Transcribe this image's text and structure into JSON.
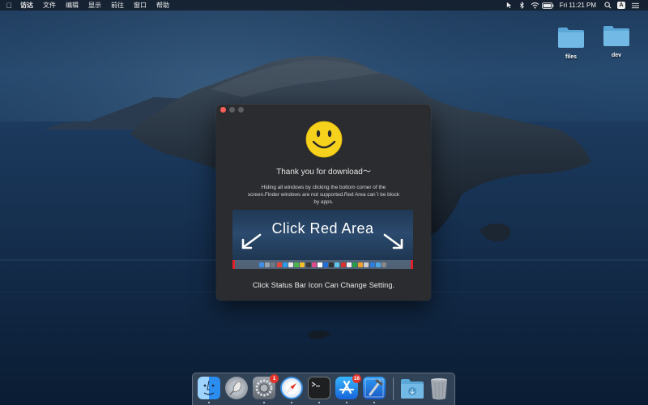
{
  "menubar": {
    "app_name": "访达",
    "items": [
      "文件",
      "编辑",
      "显示",
      "前往",
      "窗口",
      "帮助"
    ],
    "clock": "Fri 11:21 PM",
    "input_method": "A",
    "status_icons": [
      "cursor-icon",
      "bluetooth-icon",
      "wifi-icon",
      "battery-icon",
      "search-icon",
      "input-method-icon",
      "list-icon"
    ]
  },
  "desktop": {
    "folders": [
      {
        "label": "files",
        "icon": "folder-icon"
      },
      {
        "label": "dev",
        "icon": "folder-icon"
      }
    ]
  },
  "window": {
    "icon": "smiley-icon",
    "thanks": "Thank you for download～",
    "description_line1": "Hiding all windows by clicking the bottom corner of the",
    "description_line2": "screen.Finder windows are not supported.Red Area can`t be block",
    "description_line3": "by apps.",
    "demo_title": "Click  Red  Area",
    "status_tip": "Click Status Bar Icon Can Change Setting.",
    "accent_red": "#e0202a"
  },
  "dock": {
    "apps": [
      {
        "name": "Finder",
        "icon": "finder-icon",
        "running": true
      },
      {
        "name": "Launchpad",
        "icon": "launchpad-icon",
        "running": false
      },
      {
        "name": "System Preferences",
        "icon": "system-preferences-icon",
        "running": true,
        "badge": "1"
      },
      {
        "name": "Safari",
        "icon": "safari-icon",
        "running": true
      },
      {
        "name": "Terminal",
        "icon": "terminal-icon",
        "running": true
      },
      {
        "name": "App Store",
        "icon": "app-store-icon",
        "running": true,
        "badge": "16"
      },
      {
        "name": "Xcode",
        "icon": "xcode-icon",
        "running": true
      },
      {
        "name": "Downloads",
        "icon": "downloads-folder-icon",
        "running": false
      },
      {
        "name": "Trash",
        "icon": "trash-icon",
        "running": false
      }
    ]
  }
}
